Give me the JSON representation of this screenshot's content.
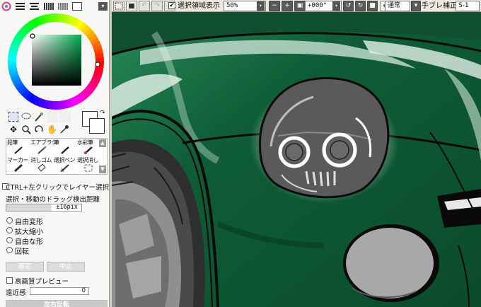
{
  "toolbar": {
    "selection_display_label": "選択領域表示",
    "selection_display_checked": "✔",
    "zoom_value": "50%",
    "zoom_minus": "−",
    "zoom_plus": "+",
    "rotation_value": "+000°",
    "blend_mode": "通常",
    "stabilizer_label": "手ブレ補正",
    "stabilizer_value": "S-1"
  },
  "color_panel": {
    "mode_icons": [
      "color-wheel-icon",
      "rgb-sliders-icon",
      "hsv-sliders-icon",
      "swatches-icon",
      "scratchpad-icon"
    ],
    "primary_color": "#ffffff",
    "secondary_color": "#ffffff"
  },
  "tool_panel": {
    "tools_row1": [
      "鉛筆",
      "エアブラシ",
      "筆",
      "水彩筆"
    ],
    "tools_row2": [
      "マーカー",
      "消しゴム",
      "選択ペン",
      "選択消し"
    ],
    "ctrl_click_label": "CTRL+左クリックでレイヤー選択",
    "drag_threshold_label": "選択・移動のドラッグ検出距離",
    "drag_threshold_value": "±16pix",
    "transform_options": [
      "自由変形",
      "拡大縮小",
      "自由な形",
      "回転"
    ],
    "confirm_button": "確定",
    "cancel_button": "中止",
    "hq_preview_label": "高画質プレビュー",
    "perspective_label": "遠近感",
    "perspective_value": "0",
    "flip_button": "左右反転"
  },
  "colors": {
    "car_body_dark": "#0e5a35",
    "car_body_mid": "#1f7a4e",
    "highlight": "#e8f3ec",
    "headlight_gray": "#5a5a5a",
    "tire": "#3a3a3a"
  }
}
